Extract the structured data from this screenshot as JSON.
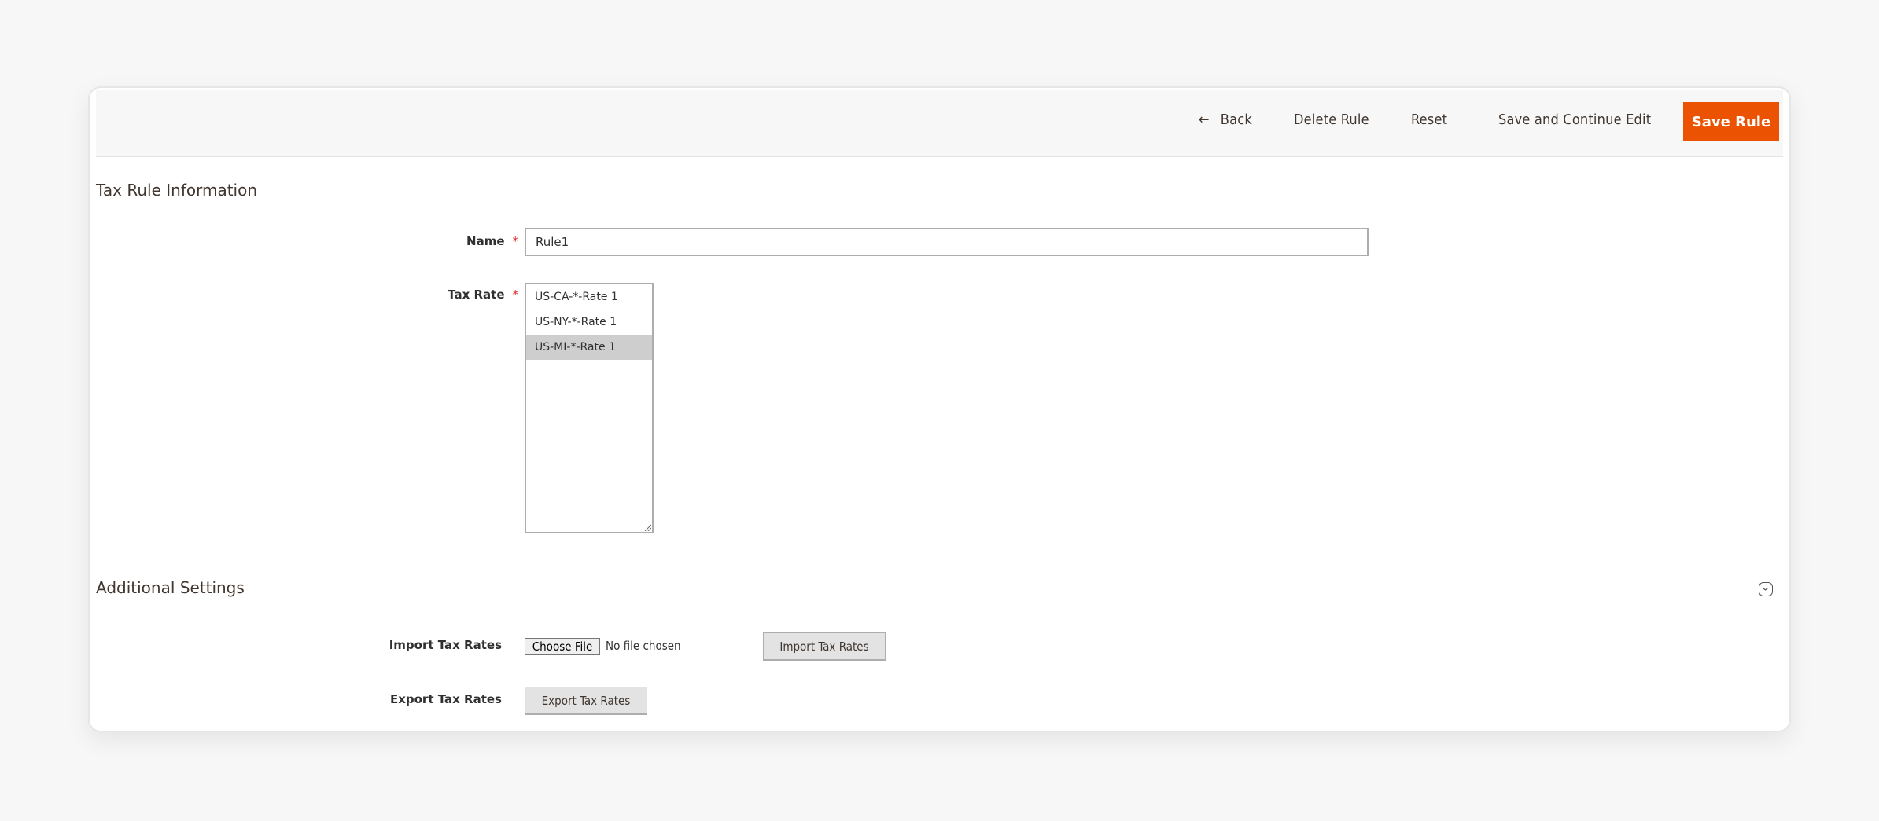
{
  "header": {
    "back_label": "Back",
    "back_icon": "arrow-left-icon",
    "delete_label": "Delete Rule",
    "reset_label": "Reset",
    "save_continue_label": "Save and Continue Edit",
    "save_label": "Save Rule"
  },
  "tax_rule_info": {
    "title": "Tax Rule Information",
    "name_label": "Name",
    "name_value": "Rule1",
    "tax_rate_label": "Tax Rate",
    "required_mark": "*",
    "tax_rate_options": [
      {
        "label": "US-CA-*-Rate 1",
        "selected": false
      },
      {
        "label": "US-NY-*-Rate 1",
        "selected": false
      },
      {
        "label": "US-MI-*-Rate 1",
        "selected": true
      }
    ]
  },
  "additional_settings": {
    "title": "Additional Settings",
    "toggle_icon": "chevron-down-circle-icon",
    "import_label": "Import Tax Rates",
    "choose_file_label": "Choose File",
    "file_status": "No file chosen",
    "import_button": "Import Tax Rates",
    "export_label": "Export Tax Rates",
    "export_button": "Export Tax Rates"
  },
  "colors": {
    "primary_button": "#eb5202",
    "required": "#e22626",
    "selected_option": "#cecece"
  }
}
